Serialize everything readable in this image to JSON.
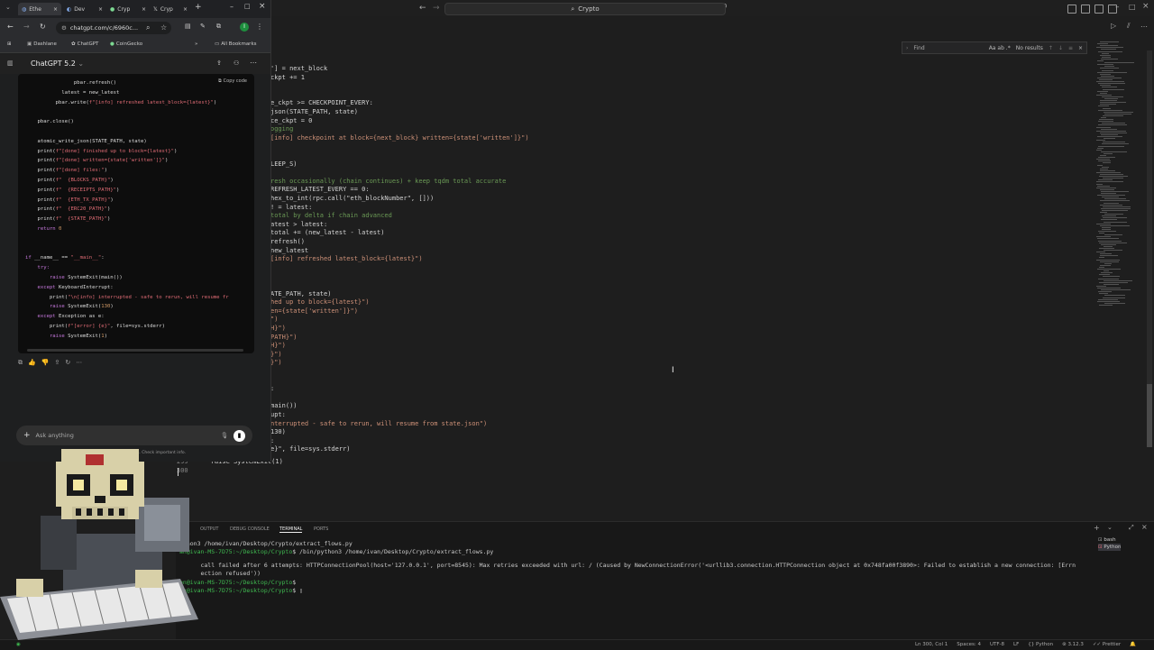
{
  "vscode": {
    "search": "Crypto",
    "find": {
      "placeholder": "Find",
      "options": "Aa ab .*",
      "result": "No results"
    },
    "code_lines": [
      {
        "t": "'] = next_block",
        "c": ""
      },
      {
        "t": "ckpt += 1",
        "c": ""
      },
      {
        "t": "",
        "c": ""
      },
      {
        "t": "",
        "c": ""
      },
      {
        "t": "e_ckpt >= CHECKPOINT_EVERY:",
        "c": ""
      },
      {
        "t": "json(STATE_PATH, state)",
        "c": ""
      },
      {
        "t": "ce_ckpt = 0",
        "c": ""
      },
      {
        "t": "ogging",
        "c": "com"
      },
      {
        "t": "[info] checkpoint at block={next_block} written={state['written']}\")",
        "c": "str"
      },
      {
        "t": "",
        "c": ""
      },
      {
        "t": "",
        "c": ""
      },
      {
        "t": "LEEP_S)",
        "c": ""
      },
      {
        "t": "",
        "c": ""
      },
      {
        "t": "resh occasionally (chain continues) + keep tqdm total accurate",
        "c": "com"
      },
      {
        "t": "REFRESH_LATEST_EVERY == 0:",
        "c": ""
      },
      {
        "t": "hex_to_int(rpc.call(\"eth_blockNumber\", []))",
        "c": ""
      },
      {
        "t": "! = latest:",
        "c": ""
      },
      {
        "t": "total by delta if chain advanced",
        "c": "com"
      },
      {
        "t": "atest > latest:",
        "c": ""
      },
      {
        "t": "total += (new_latest - latest)",
        "c": ""
      },
      {
        "t": "refresh()",
        "c": ""
      },
      {
        "t": "new_latest",
        "c": ""
      },
      {
        "t": "[info] refreshed latest_block={latest}\")",
        "c": "str"
      },
      {
        "t": "",
        "c": ""
      },
      {
        "t": "",
        "c": ""
      },
      {
        "t": "",
        "c": ""
      },
      {
        "t": "ATE_PATH, state)",
        "c": ""
      },
      {
        "t": "hed up to block={latest}\")",
        "c": "str"
      },
      {
        "t": "en={state['written']}\")",
        "c": "str"
      },
      {
        "t": "\")",
        "c": "str"
      },
      {
        "t": "H}\")",
        "c": "str"
      },
      {
        "t": "PATH}\")",
        "c": "str"
      },
      {
        "t": "H}\")",
        "c": "str"
      },
      {
        "t": "}\")",
        "c": "str"
      },
      {
        "t": "}\")",
        "c": "str"
      },
      {
        "t": "",
        "c": ""
      },
      {
        "t": "",
        "c": ""
      },
      {
        "t": ":",
        "c": ""
      },
      {
        "t": "",
        "c": ""
      },
      {
        "t": "main())",
        "c": ""
      },
      {
        "t": "upt:",
        "c": ""
      },
      {
        "t": "nterrupted - safe to rerun, will resume from state.json\")",
        "c": "str"
      },
      {
        "t": "130)",
        "c": ""
      },
      {
        "t": ":",
        "c": ""
      },
      {
        "t": "e}\", file=sys.stderr)",
        "c": ""
      }
    ],
    "bottom_lines": [
      {
        "num": "299",
        "text": "        raise SystemExit(1)"
      },
      {
        "num": "300",
        "text": ""
      }
    ],
    "panel_tabs": [
      "OUTPUT",
      "DEBUG CONSOLE",
      "TERMINAL",
      "PORTS"
    ],
    "terminal_lines": [
      {
        "parts": [
          {
            "t": "ython3 /home/ivan/Desktop/Crypto/extract_flows.py",
            "c": ""
          }
        ]
      },
      {
        "parts": [
          {
            "t": "an@ivan-MS-7D75:~/Desktop/Crypto",
            "c": "green"
          },
          {
            "t": "$ /bin/python3 /home/ivan/Desktop/Crypto/extract_flows.py",
            "c": ""
          }
        ]
      },
      {
        "parts": [
          {
            "t": "      call failed after 6 attempts: HTTPConnectionPool(host='127.0.0.1', port=8545): Max retries exceeded with url: / (Caused by NewConnectionError('<urllib3.connection.HTTPConnection object at 0x748fa00f3890>: Failed to establish a new connection: [Errn",
            "c": ""
          }
        ]
      },
      {
        "parts": [
          {
            "t": "      ection refused'))",
            "c": ""
          }
        ]
      },
      {
        "parts": [
          {
            "t": "an@ivan-MS-7D75:~/Desktop/Crypto",
            "c": "green"
          },
          {
            "t": "$",
            "c": ""
          }
        ]
      },
      {
        "parts": [
          {
            "t": "an@ivan-MS-7D75:~/Desktop/Crypto",
            "c": "green"
          },
          {
            "t": "$ ▯",
            "c": ""
          }
        ]
      }
    ],
    "terminals": [
      "bash",
      "Python"
    ],
    "status": {
      "position": "Ln 300, Col 1",
      "spaces": "Spaces: 4",
      "encoding": "UTF-8",
      "eol": "LF",
      "language": "Python",
      "version": "3.12.3",
      "prettier": "Prettier"
    }
  },
  "chrome": {
    "tabs": [
      "Ethe",
      "Dev",
      "Cryp",
      "Cryp"
    ],
    "url": "chatgpt.com/c/6960c...",
    "bookmarks": [
      "Dashlane",
      "ChatGPT",
      "CoinGecko"
    ],
    "all_bookmarks": "All Bookmarks",
    "gpt_title": "ChatGPT 5.2",
    "copy_code": "Copy code",
    "code_lines": [
      {
        "parts": [
          {
            "t": "                pbar.refresh()",
            "c": ""
          }
        ]
      },
      {
        "parts": [
          {
            "t": "            latest = new_latest",
            "c": ""
          }
        ]
      },
      {
        "parts": [
          {
            "t": "          pbar.write(",
            "c": ""
          },
          {
            "t": "f\"[info] refreshed latest_block={latest}\"",
            "c": "str"
          },
          {
            "t": ")",
            "c": ""
          }
        ]
      },
      {
        "parts": [
          {
            "t": "",
            "c": ""
          }
        ]
      },
      {
        "parts": [
          {
            "t": "    pbar.close()",
            "c": ""
          }
        ]
      },
      {
        "parts": [
          {
            "t": "",
            "c": ""
          }
        ]
      },
      {
        "parts": [
          {
            "t": "    atomic_write_json(STATE_PATH, state)",
            "c": ""
          }
        ]
      },
      {
        "parts": [
          {
            "t": "    print(",
            "c": ""
          },
          {
            "t": "f\"[done] finished up to block={latest}\"",
            "c": "str"
          },
          {
            "t": ")",
            "c": ""
          }
        ]
      },
      {
        "parts": [
          {
            "t": "    print(",
            "c": ""
          },
          {
            "t": "f\"[done] written={state['written']}\"",
            "c": "str"
          },
          {
            "t": ")",
            "c": ""
          }
        ]
      },
      {
        "parts": [
          {
            "t": "    print(",
            "c": ""
          },
          {
            "t": "f\"[done] files:\"",
            "c": "str"
          },
          {
            "t": ")",
            "c": ""
          }
        ]
      },
      {
        "parts": [
          {
            "t": "    print(",
            "c": ""
          },
          {
            "t": "f\"  {BLOCKS_PATH}\"",
            "c": "str"
          },
          {
            "t": ")",
            "c": ""
          }
        ]
      },
      {
        "parts": [
          {
            "t": "    print(",
            "c": ""
          },
          {
            "t": "f\"  {RECEIPTS_PATH}\"",
            "c": "str"
          },
          {
            "t": ")",
            "c": ""
          }
        ]
      },
      {
        "parts": [
          {
            "t": "    print(",
            "c": ""
          },
          {
            "t": "f\"  {ETH_TX_PATH}\"",
            "c": "str"
          },
          {
            "t": ")",
            "c": ""
          }
        ]
      },
      {
        "parts": [
          {
            "t": "    print(",
            "c": ""
          },
          {
            "t": "f\"  {ERC20_PATH}\"",
            "c": "str"
          },
          {
            "t": ")",
            "c": ""
          }
        ]
      },
      {
        "parts": [
          {
            "t": "    print(",
            "c": ""
          },
          {
            "t": "f\"  {STATE_PATH}\"",
            "c": "str"
          },
          {
            "t": ")",
            "c": ""
          }
        ]
      },
      {
        "parts": [
          {
            "t": "    return ",
            "c": "kw"
          },
          {
            "t": "0",
            "c": "num"
          }
        ]
      },
      {
        "parts": [
          {
            "t": "",
            "c": ""
          }
        ]
      },
      {
        "parts": [
          {
            "t": "",
            "c": ""
          }
        ]
      },
      {
        "parts": [
          {
            "t": "if ",
            "c": "kw"
          },
          {
            "t": "__name__ == ",
            "c": ""
          },
          {
            "t": "\"__main__\"",
            "c": "str"
          },
          {
            "t": ":",
            "c": ""
          }
        ]
      },
      {
        "parts": [
          {
            "t": "    try:",
            "c": "kw"
          }
        ]
      },
      {
        "parts": [
          {
            "t": "        raise ",
            "c": "kw"
          },
          {
            "t": "SystemExit(main())",
            "c": ""
          }
        ]
      },
      {
        "parts": [
          {
            "t": "    except ",
            "c": "kw"
          },
          {
            "t": "KeyboardInterrupt:",
            "c": ""
          }
        ]
      },
      {
        "parts": [
          {
            "t": "        print(",
            "c": ""
          },
          {
            "t": "\"\\n[info] interrupted - safe to rerun, will resume fr",
            "c": "str"
          }
        ]
      },
      {
        "parts": [
          {
            "t": "        raise ",
            "c": "kw"
          },
          {
            "t": "SystemExit(",
            "c": ""
          },
          {
            "t": "130",
            "c": "num"
          },
          {
            "t": ")",
            "c": ""
          }
        ]
      },
      {
        "parts": [
          {
            "t": "    except ",
            "c": "kw"
          },
          {
            "t": "Exception as e:",
            "c": ""
          }
        ]
      },
      {
        "parts": [
          {
            "t": "        print(",
            "c": ""
          },
          {
            "t": "f\"[error] {e}\"",
            "c": "str"
          },
          {
            "t": ", file=sys.stderr)",
            "c": ""
          }
        ]
      },
      {
        "parts": [
          {
            "t": "        raise ",
            "c": "kw"
          },
          {
            "t": "SystemExit(",
            "c": ""
          },
          {
            "t": "1",
            "c": "num"
          },
          {
            "t": ")",
            "c": ""
          }
        ]
      }
    ],
    "input_placeholder": "Ask anything",
    "footnote": "stakes. Check important info."
  }
}
